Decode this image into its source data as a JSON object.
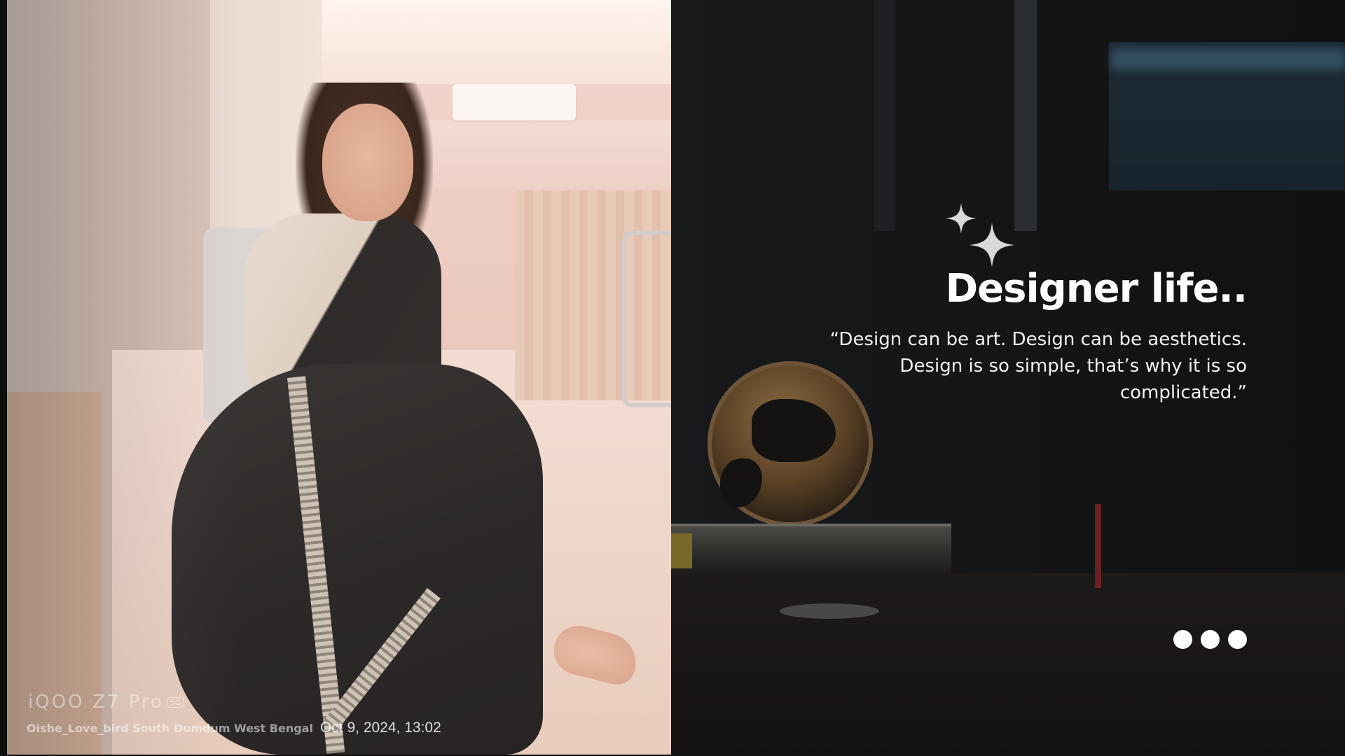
{
  "slide": {
    "heading": "Designer life..",
    "quote": "“Design can be art. Design can be aesthetics. Design is so simple, that’s why it is so complicated.”",
    "pagination_dots": 3
  },
  "photo_watermark": {
    "brand": "iQOO Z7 Pro",
    "brand_badge": "5G",
    "location": "Oishe_Love_bird  South Dumdum West Bengal",
    "timestamp": "Oct 9, 2024, 13:02"
  },
  "colors": {
    "background_dark": "#141516",
    "text": "#ffffff",
    "accent_sparkle": "#d9d9d9"
  },
  "icons": {
    "decoration": "sparkle-icon"
  }
}
